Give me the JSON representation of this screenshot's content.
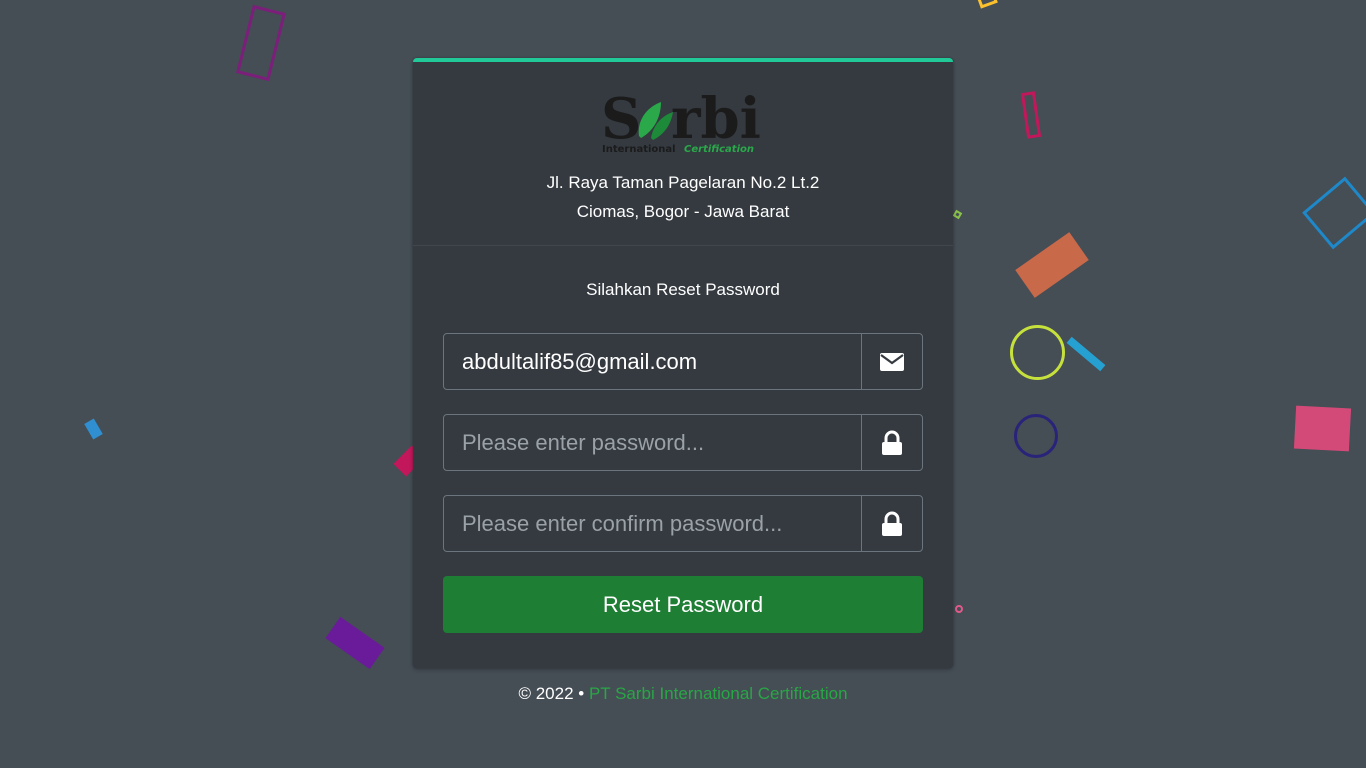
{
  "brand": {
    "logo_text_main": "Sarbi",
    "logo_text_sub_1": "International",
    "logo_text_sub_2": "Certification"
  },
  "header": {
    "address_line_1": "Jl. Raya Taman Pagelaran No.2 Lt.2",
    "address_line_2": "Ciomas, Bogor - Jawa Barat"
  },
  "form": {
    "subtitle": "Silahkan Reset Password",
    "email_value": "abdultalif85@gmail.com",
    "email_icon": "envelope-icon",
    "password_placeholder": "Please enter password...",
    "password_icon": "lock-icon",
    "confirm_placeholder": "Please enter confirm password...",
    "confirm_icon": "lock-icon",
    "submit_label": "Reset Password"
  },
  "footer": {
    "copyright": "© 2022 •",
    "company": "PT Sarbi International Certification"
  },
  "colors": {
    "background": "#454d55",
    "card": "#343a40",
    "card_accent": "#20c997",
    "button": "#1e7e34",
    "link": "#28a745"
  }
}
